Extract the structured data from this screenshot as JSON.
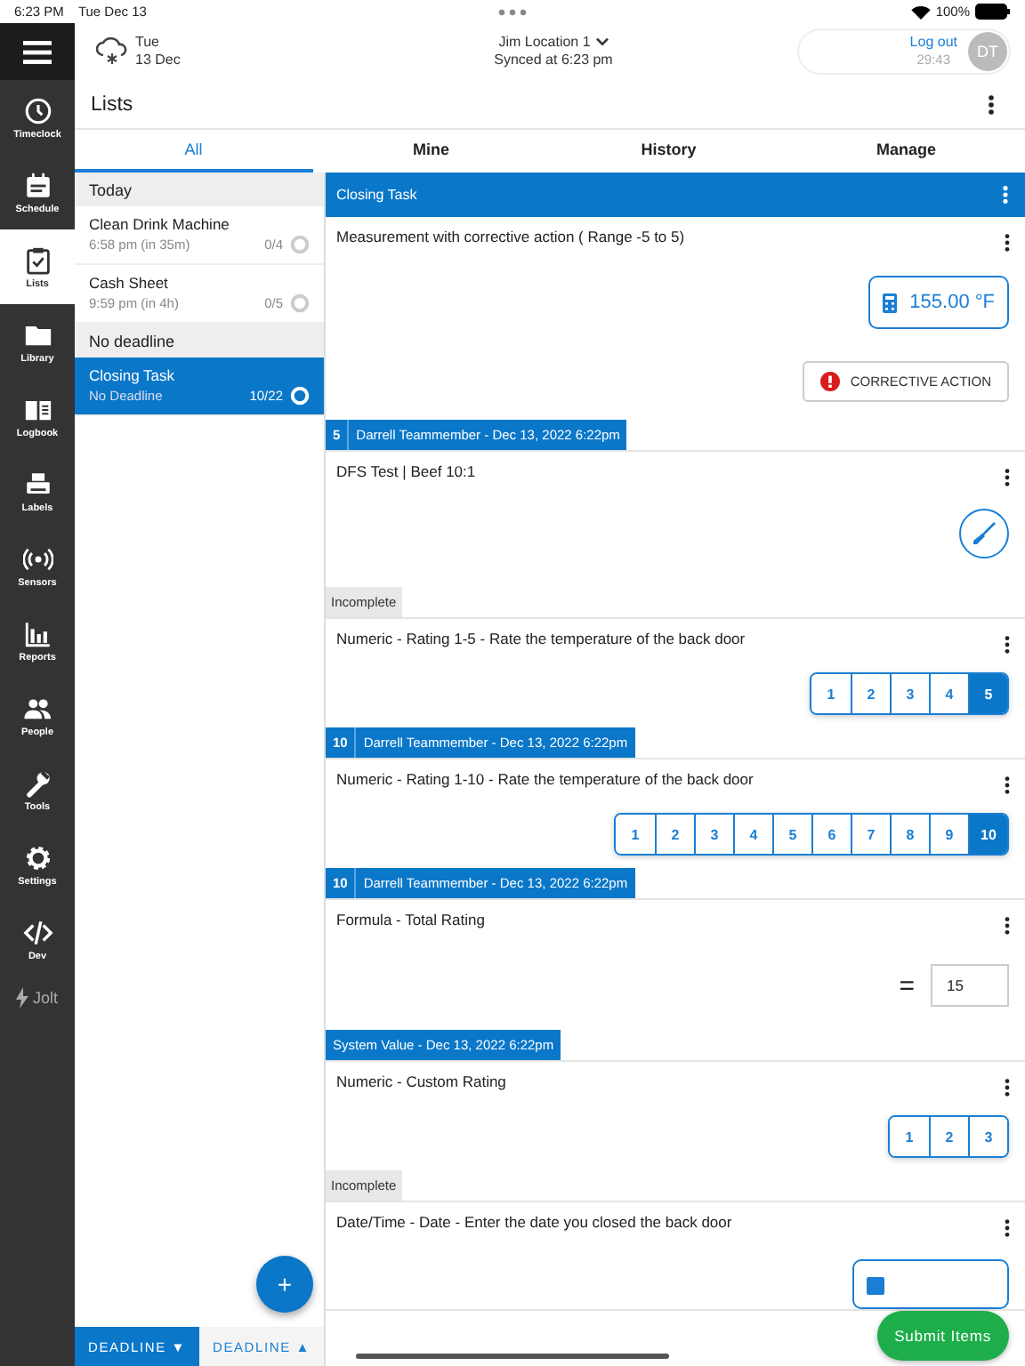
{
  "status_bar": {
    "time": "6:23 PM",
    "date": "Tue Dec 13",
    "battery": "100%"
  },
  "nav": [
    {
      "label": "Timeclock",
      "selected": false
    },
    {
      "label": "Schedule",
      "selected": false
    },
    {
      "label": "Lists",
      "selected": true
    },
    {
      "label": "Library",
      "selected": false
    },
    {
      "label": "Logbook",
      "selected": false
    },
    {
      "label": "Labels",
      "selected": false
    },
    {
      "label": "Sensors",
      "selected": false
    },
    {
      "label": "Reports",
      "selected": false
    },
    {
      "label": "People",
      "selected": false
    },
    {
      "label": "Tools",
      "selected": false
    },
    {
      "label": "Settings",
      "selected": false
    },
    {
      "label": "Dev",
      "selected": false
    }
  ],
  "brand": "Jolt",
  "header": {
    "weather_day": "Tue",
    "weather_date": "13 Dec",
    "location": "Jim Location 1",
    "synced": "Synced at 6:23 pm",
    "logout": "Log out",
    "timer": "29:43",
    "avatar": "DT"
  },
  "page_title": "Lists",
  "tabs": [
    {
      "label": "All",
      "selected": true
    },
    {
      "label": "Mine",
      "selected": false
    },
    {
      "label": "History",
      "selected": false
    },
    {
      "label": "Manage",
      "selected": false
    }
  ],
  "list_sections": [
    {
      "heading": "Today",
      "items": [
        {
          "title": "Clean Drink Machine",
          "subtitle": "6:58 pm (in 35m)",
          "count": "0/4",
          "selected": false
        },
        {
          "title": "Cash Sheet",
          "subtitle": "9:59 pm (in 4h)",
          "count": "0/5",
          "selected": false
        }
      ]
    },
    {
      "heading": "No deadline",
      "items": [
        {
          "title": "Closing Task",
          "subtitle": "No Deadline",
          "count": "10/22",
          "selected": true
        }
      ]
    }
  ],
  "fab": "+",
  "sort_buttons": [
    {
      "label": "DEADLINE",
      "arrow": "▼",
      "selected": true
    },
    {
      "label": "DEADLINE",
      "arrow": "▲",
      "selected": false
    }
  ],
  "detail": {
    "title": "Closing Task",
    "tasks": [
      {
        "kind": "measurement",
        "title": "Measurement with corrective action ( Range -5 to 5)",
        "value": "155.00 °F",
        "action": "CORRECTIVE ACTION",
        "footer": {
          "kind": "response",
          "number": "5",
          "text": "Darrell Teammember - Dec 13, 2022 6:22pm"
        }
      },
      {
        "kind": "probe",
        "title": "DFS Test | Beef 10:1",
        "footer": {
          "kind": "status",
          "text": "Incomplete"
        }
      },
      {
        "kind": "rating",
        "title": "Numeric - Rating 1-5 - Rate the temperature of the back door",
        "options": [
          {
            "label": "1",
            "selected": false
          },
          {
            "label": "2",
            "selected": false
          },
          {
            "label": "3",
            "selected": false
          },
          {
            "label": "4",
            "selected": false
          },
          {
            "label": "5",
            "selected": true
          }
        ],
        "footer": {
          "kind": "response",
          "number": "10",
          "text": "Darrell Teammember - Dec 13, 2022 6:22pm"
        }
      },
      {
        "kind": "rating",
        "title": "Numeric - Rating 1-10 - Rate the temperature of the back door",
        "options": [
          {
            "label": "1",
            "selected": false
          },
          {
            "label": "2",
            "selected": false
          },
          {
            "label": "3",
            "selected": false
          },
          {
            "label": "4",
            "selected": false
          },
          {
            "label": "5",
            "selected": false
          },
          {
            "label": "6",
            "selected": false
          },
          {
            "label": "7",
            "selected": false
          },
          {
            "label": "8",
            "selected": false
          },
          {
            "label": "9",
            "selected": false
          },
          {
            "label": "10",
            "selected": true
          }
        ],
        "footer": {
          "kind": "response",
          "number": "10",
          "text": "Darrell Teammember - Dec 13, 2022 6:22pm"
        }
      },
      {
        "kind": "formula",
        "title": "Formula - Total Rating",
        "operator": "=",
        "value": "15",
        "footer": {
          "kind": "response",
          "text": "System Value - Dec 13, 2022 6:22pm"
        }
      },
      {
        "kind": "rating",
        "title": "Numeric - Custom Rating",
        "options": [
          {
            "label": "1",
            "selected": false
          },
          {
            "label": "2",
            "selected": false
          },
          {
            "label": "3",
            "selected": false
          }
        ],
        "footer": {
          "kind": "status",
          "text": "Incomplete"
        }
      },
      {
        "kind": "date",
        "title": "Date/Time - Date - Enter the date you closed the back door"
      }
    ]
  },
  "submit": "Submit Items"
}
